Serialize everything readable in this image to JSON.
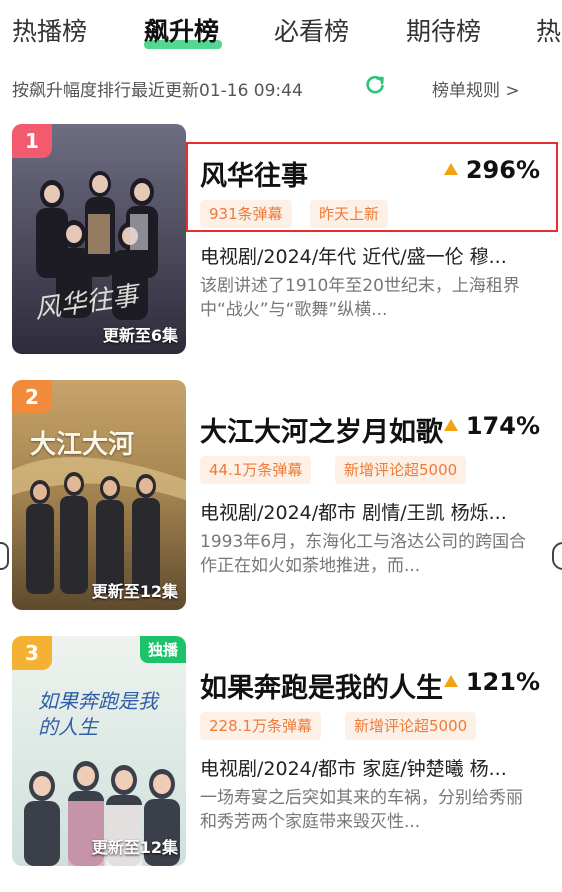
{
  "tabs": [
    {
      "label": "热播榜",
      "active": false
    },
    {
      "label": "飙升榜",
      "active": true
    },
    {
      "label": "必看榜",
      "active": false
    },
    {
      "label": "期待榜",
      "active": false
    },
    {
      "label": "热",
      "active": false
    }
  ],
  "subbar": {
    "sort_text": "按飙升幅度排行最近更新01-16 09:44",
    "rules_label": "榜单规则 >"
  },
  "items": [
    {
      "rank": "1",
      "title": "风华往事",
      "trend": "296%",
      "tags": [
        "931条弹幕",
        "昨天上新"
      ],
      "meta": "电视剧/2024/年代 近代/盛一伦 穆...",
      "desc": "该剧讲述了1910年至20世纪末，上海租界中“战火”与“歌舞”纵横...",
      "poster_update": "更新至6集",
      "poster_title_art": "风华往事"
    },
    {
      "rank": "2",
      "title": "大江大河之岁月如歌",
      "trend": "174%",
      "tags": [
        "44.1万条弹幕",
        "新增评论超5000"
      ],
      "meta": "电视剧/2024/都市 剧情/王凯 杨烁...",
      "desc": "1993年6月，东海化工与洛达公司的跨国合作正在如火如荼地推进，而...",
      "poster_update": "更新至12集",
      "poster_title_art": "大江大河"
    },
    {
      "rank": "3",
      "title": "如果奔跑是我的人生",
      "trend": "121%",
      "tags": [
        "228.1万条弹幕",
        "新增评论超5000"
      ],
      "meta": "电视剧/2024/都市 家庭/钟楚曦 杨...",
      "desc": "一场寿宴之后突如其来的车祸，分别给秀丽和秀芳两个家庭带来毁灭性...",
      "poster_update": "更新至12集",
      "exclusive": "独播",
      "poster_title_art": "如果奔跑是我的人生"
    }
  ],
  "colors": {
    "accent_green": "#35d07f",
    "trend_up": "#f2a311",
    "tag_text": "#ef7b38",
    "tag_bg": "#fdf0e6",
    "highlight_box": "#e62e2e",
    "rank_1": "#f25a6e",
    "rank_2": "#f28a3c",
    "rank_3": "#f5b134"
  },
  "icons": {
    "refresh": "refresh-icon",
    "trend": "triangle-up-icon"
  }
}
